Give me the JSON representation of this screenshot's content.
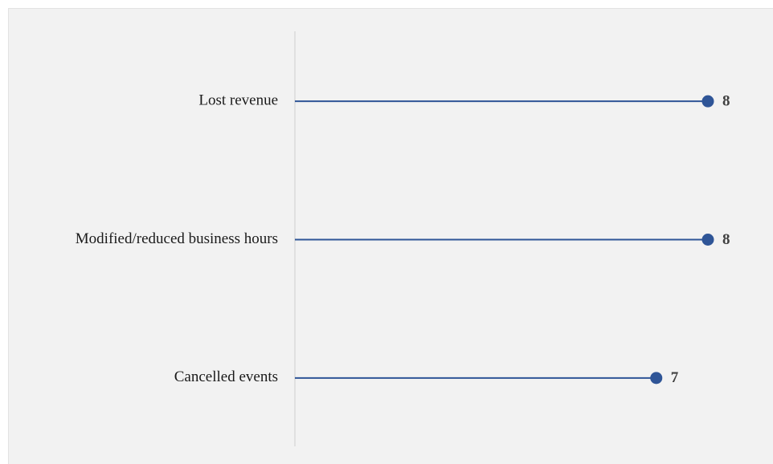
{
  "chart_data": {
    "type": "lollipop",
    "categories": [
      "Lost revenue",
      "Modified/reduced business hours",
      "Cancelled events"
    ],
    "values": [
      8,
      8,
      7
    ],
    "title": "",
    "xlabel": "",
    "ylabel": "",
    "xlim": [
      0,
      8
    ],
    "grid": false,
    "legend": "none",
    "colors": {
      "series": "#2f5597",
      "axis": "#d9d9d9",
      "background": "#f2f2f2",
      "value_label": "#404040"
    }
  }
}
